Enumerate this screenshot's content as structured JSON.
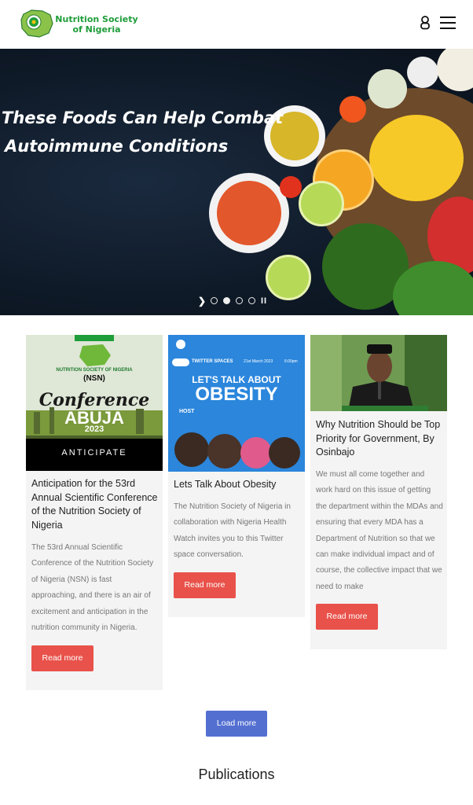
{
  "header": {
    "logo_text_line1": "Nutrition Society",
    "logo_text_line2": "of Nigeria",
    "user_icon": "user-icon",
    "menu_icon": "hamburger-menu-icon"
  },
  "hero": {
    "title_line1": "These Foods Can Help Combat",
    "title_line2": "Autoimmune Conditions",
    "carousel": {
      "slides": 4,
      "active_index": 1,
      "play_glyph": "❯",
      "pause_glyph": "II"
    }
  },
  "cards": [
    {
      "image_texts": [
        "NUTRITION SOCIETY OF NIGERIA",
        "(NSN)",
        "Conference",
        "ABUJA",
        "2023",
        "ANTICIPATE"
      ],
      "title": "Anticipation for the 53rd Annual Scientific Conference of the Nutrition Society of Nigeria",
      "excerpt": "The 53rd Annual Scientific Conference of the Nutrition Society of Nigeria (NSN) is fast approaching, and there is an air of excitement and anticipation in the nutrition community in Nigeria.",
      "button": "Read more"
    },
    {
      "image_texts": [
        "TWITTER SPACES",
        "21st March 2023",
        "6:00pm",
        "LET'S TALK ABOUT",
        "OBESITY",
        "HOST"
      ],
      "title": "Lets Talk About Obesity",
      "excerpt": "The Nutrition Society of Nigeria in collaboration with Nigeria Health Watch invites you to this Twitter space conversation.",
      "button": "Read more"
    },
    {
      "title": "Why Nutrition Should be Top Priority for Government, By Osinbajo",
      "excerpt": "We must all come together and work hard on this issue of getting the department within the MDAs and ensuring that every MDA has a Department of Nutrition so that we can make individual impact and of course, the collective impact that we need to make",
      "button": "Read more"
    }
  ],
  "load_more": "Load more",
  "publications_heading": "Publications",
  "colors": {
    "brand_green": "#1f9d3a",
    "button_red": "#e8524a",
    "button_blue": "#5370d1",
    "card_bg": "#f4f4f4"
  }
}
